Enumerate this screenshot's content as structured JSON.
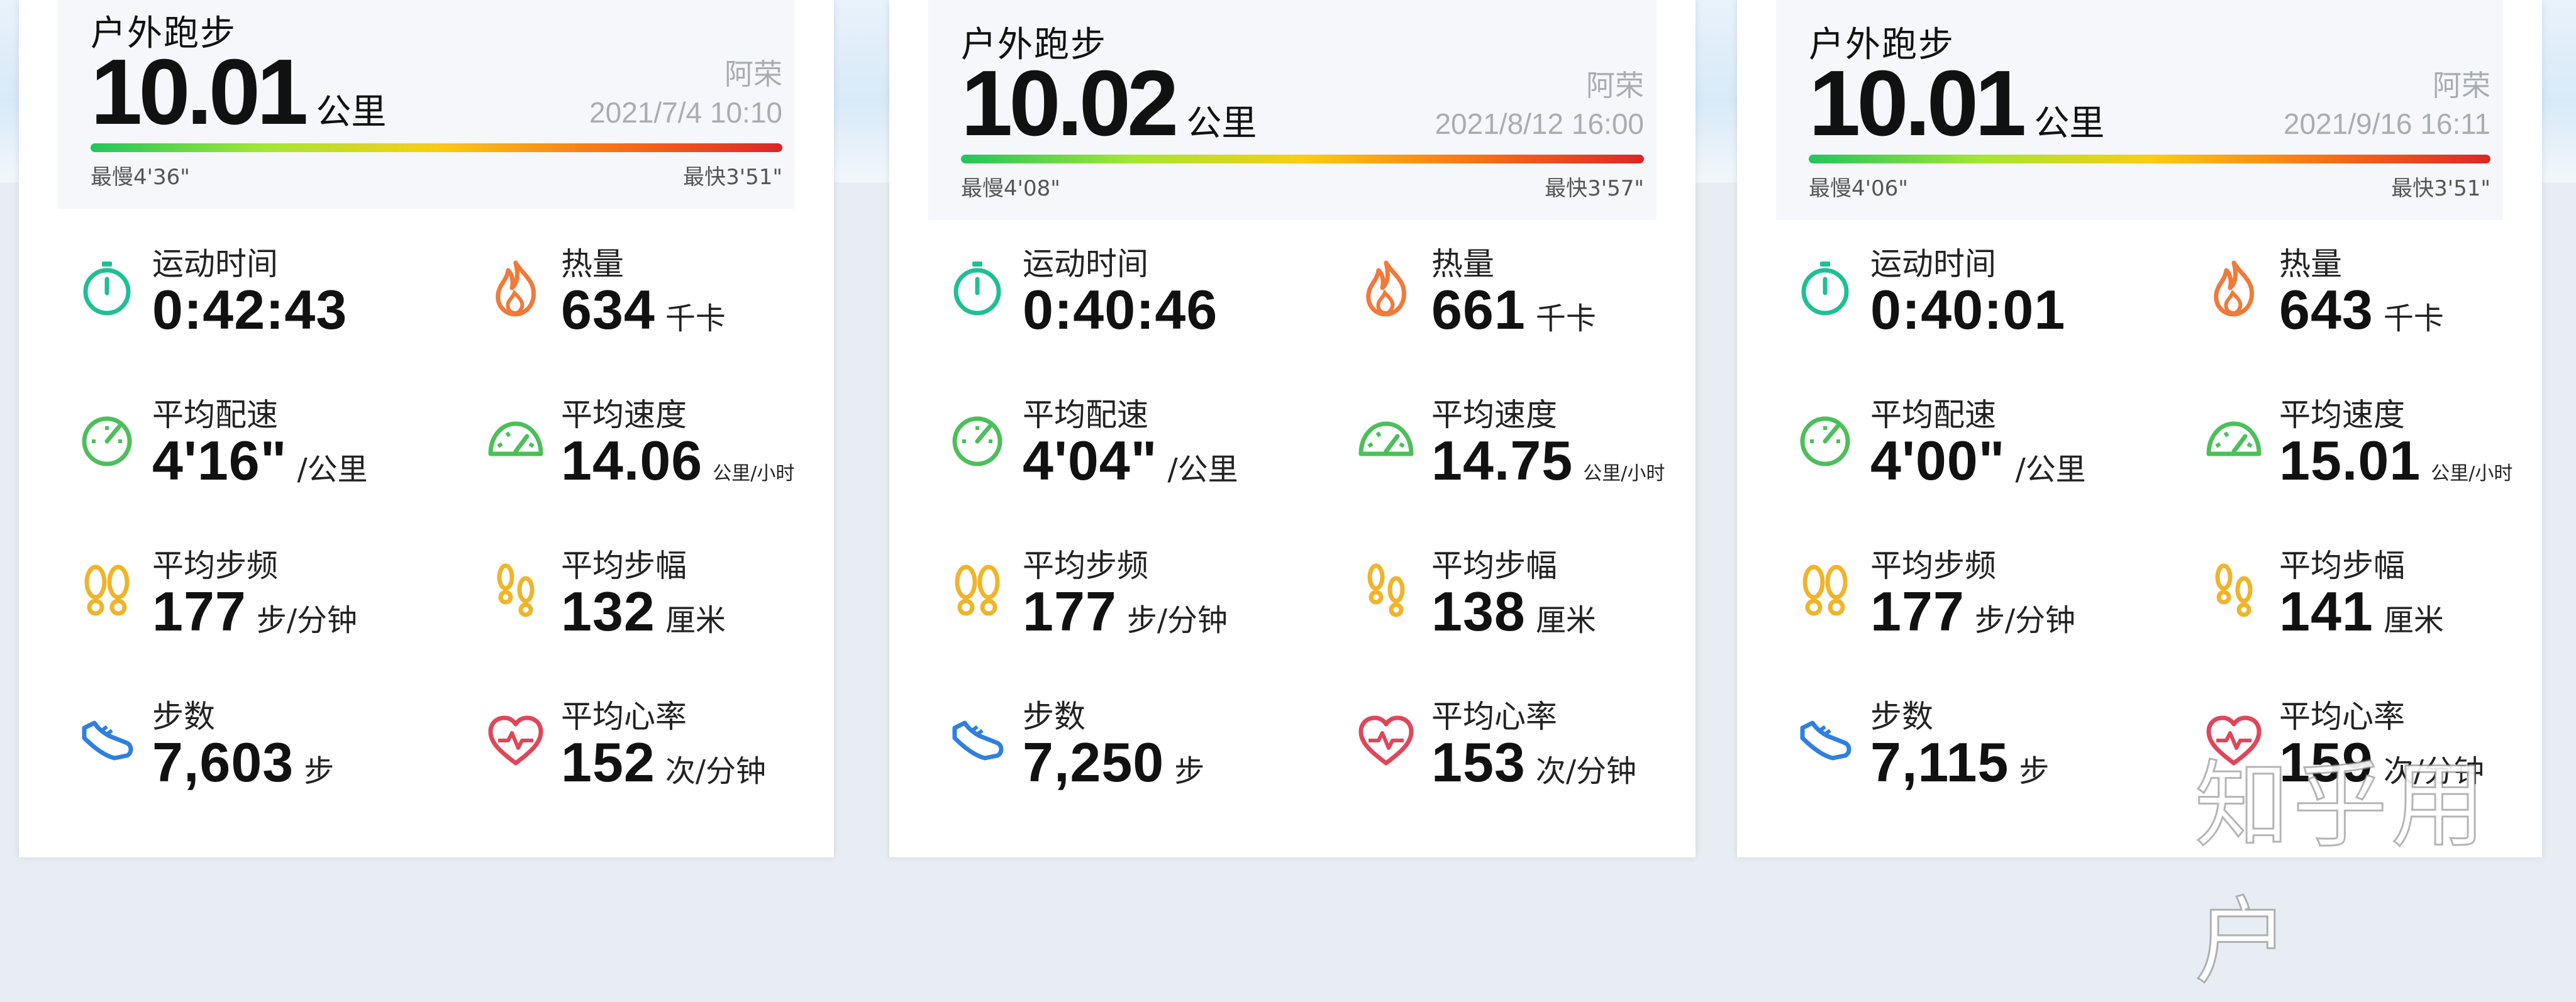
{
  "cards": [
    {
      "activity_type": "户外跑步",
      "distance": "10.01",
      "distance_unit": "公里",
      "user": "阿荣",
      "datetime": "2021/7/4 10:10",
      "pace_slow": "最慢4'36\"",
      "pace_fast": "最快3'51\"",
      "metrics": [
        {
          "label": "运动时间",
          "value": "0:42:43",
          "unit": ""
        },
        {
          "label": "热量",
          "value": "634",
          "unit": "千卡"
        },
        {
          "label": "平均配速",
          "value": "4'16\"",
          "unit": "/公里"
        },
        {
          "label": "平均速度",
          "value": "14.06",
          "unit": "公里/小时"
        },
        {
          "label": "平均步频",
          "value": "177",
          "unit": "步/分钟"
        },
        {
          "label": "平均步幅",
          "value": "132",
          "unit": "厘米"
        },
        {
          "label": "步数",
          "value": "7,603",
          "unit": "步"
        },
        {
          "label": "平均心率",
          "value": "152",
          "unit": "次/分钟"
        }
      ]
    },
    {
      "activity_type": "户外跑步",
      "distance": "10.02",
      "distance_unit": "公里",
      "user": "阿荣",
      "datetime": "2021/8/12 16:00",
      "pace_slow": "最慢4'08\"",
      "pace_fast": "最快3'57\"",
      "metrics": [
        {
          "label": "运动时间",
          "value": "0:40:46",
          "unit": ""
        },
        {
          "label": "热量",
          "value": "661",
          "unit": "千卡"
        },
        {
          "label": "平均配速",
          "value": "4'04\"",
          "unit": "/公里"
        },
        {
          "label": "平均速度",
          "value": "14.75",
          "unit": "公里/小时"
        },
        {
          "label": "平均步频",
          "value": "177",
          "unit": "步/分钟"
        },
        {
          "label": "平均步幅",
          "value": "138",
          "unit": "厘米"
        },
        {
          "label": "步数",
          "value": "7,250",
          "unit": "步"
        },
        {
          "label": "平均心率",
          "value": "153",
          "unit": "次/分钟"
        }
      ]
    },
    {
      "activity_type": "户外跑步",
      "distance": "10.01",
      "distance_unit": "公里",
      "user": "阿荣",
      "datetime": "2021/9/16 16:11",
      "pace_slow": "最慢4'06\"",
      "pace_fast": "最快3'51\"",
      "metrics": [
        {
          "label": "运动时间",
          "value": "0:40:01",
          "unit": ""
        },
        {
          "label": "热量",
          "value": "643",
          "unit": "千卡"
        },
        {
          "label": "平均配速",
          "value": "4'00\"",
          "unit": "/公里"
        },
        {
          "label": "平均速度",
          "value": "15.01",
          "unit": "公里/小时"
        },
        {
          "label": "平均步频",
          "value": "177",
          "unit": "步/分钟"
        },
        {
          "label": "平均步幅",
          "value": "141",
          "unit": "厘米"
        },
        {
          "label": "步数",
          "value": "7,115",
          "unit": "步"
        },
        {
          "label": "平均心率",
          "value": "159",
          "unit": "次/分钟"
        }
      ]
    }
  ],
  "icons": [
    "stopwatch-icon",
    "flame-icon",
    "gauge-icon",
    "speedometer-icon",
    "footprints-icon",
    "footprints-small-icon",
    "shoe-icon",
    "heart-rate-icon"
  ],
  "colors": {
    "pace_gradient": [
      "#22c55e",
      "#a3e635",
      "#facc15",
      "#f97316",
      "#dc2626"
    ],
    "stopwatch": "#1fbf95",
    "flame": "#f07a3a",
    "gauge": "#4cbf5a",
    "footprints": "#f0b429",
    "shoe": "#2f7fe0",
    "heart": "#e0465a"
  },
  "watermark": "知乎用户"
}
